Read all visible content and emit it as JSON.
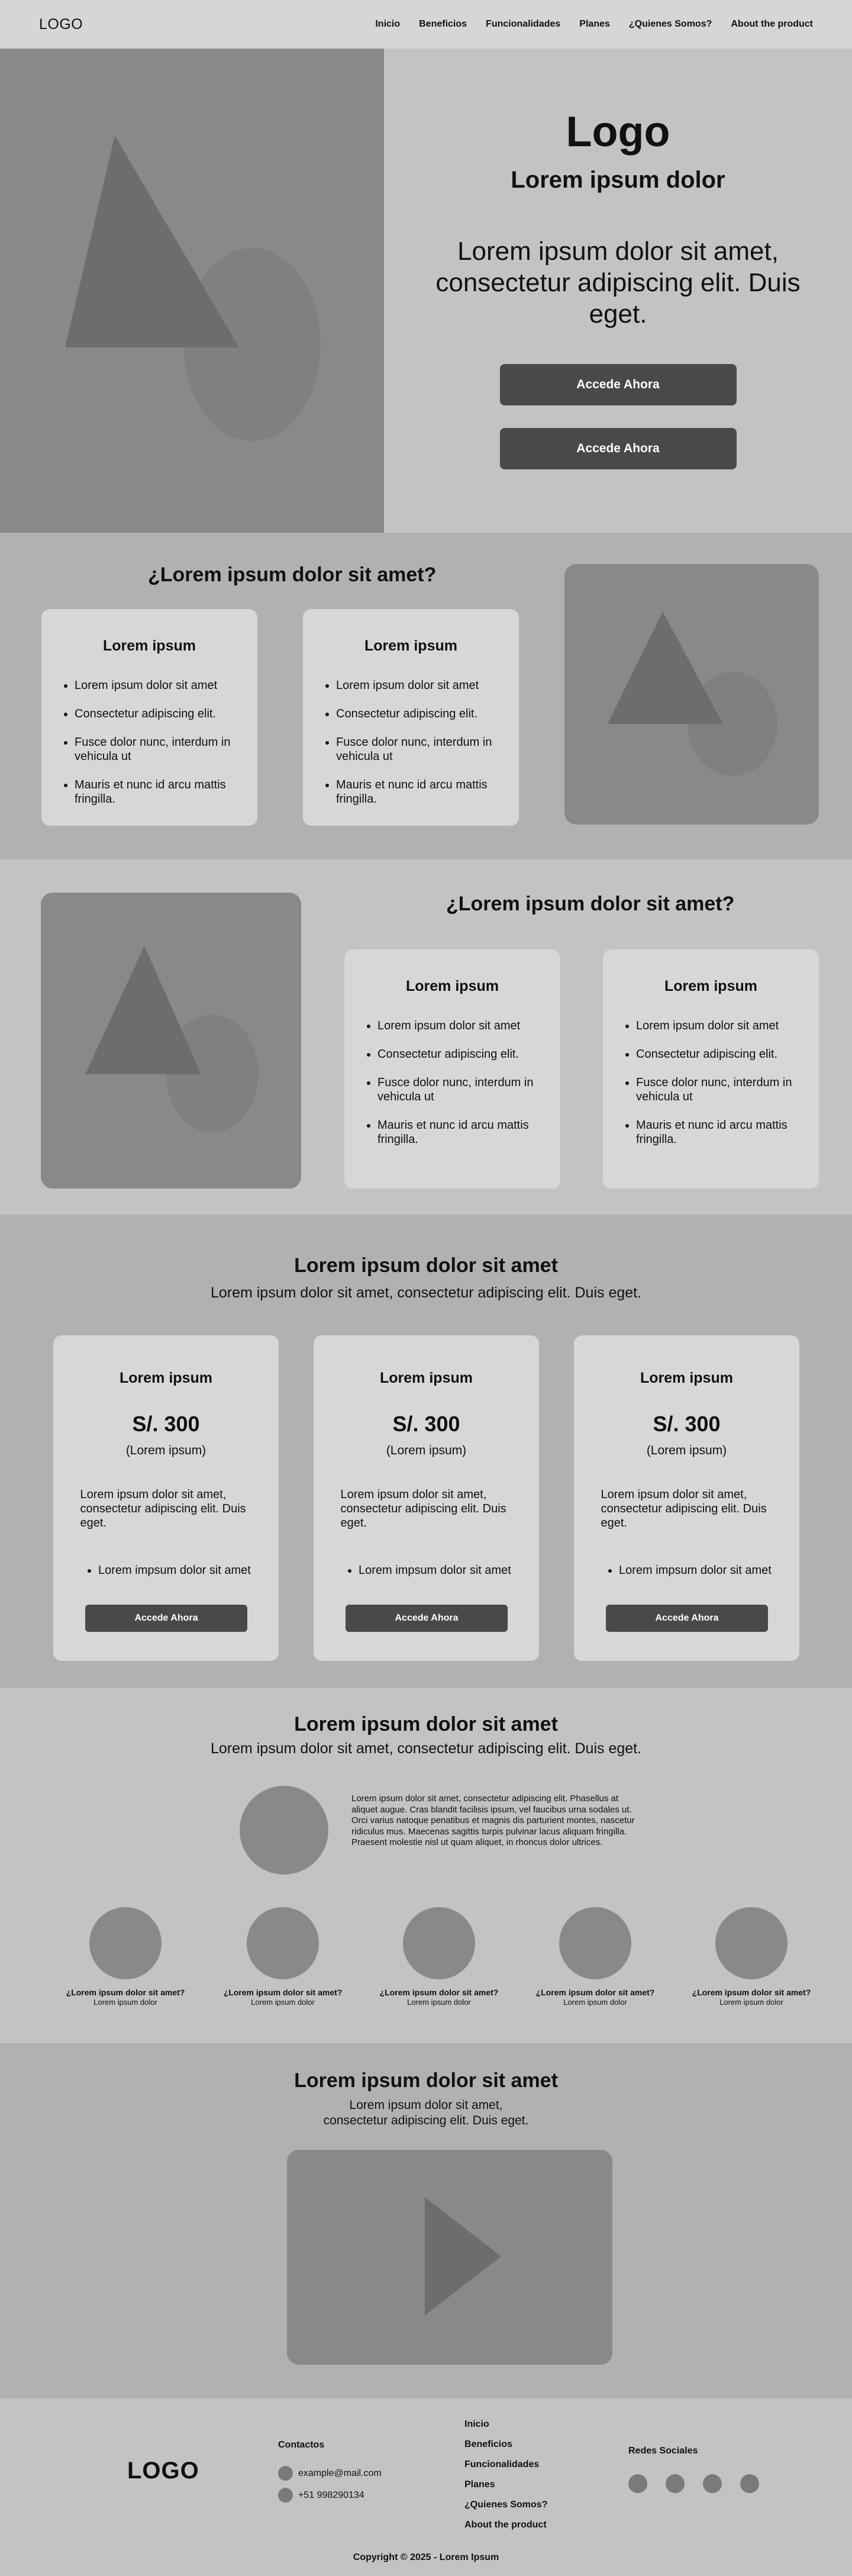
{
  "nav": {
    "logo": "LOGO",
    "items": [
      "Inicio",
      "Beneficios",
      "Funcionalidades",
      "Planes",
      "¿Quienes Somos?",
      "About the product"
    ]
  },
  "hero": {
    "title": "Logo",
    "subtitle": "Lorem ipsum dolor",
    "text": "Lorem ipsum dolor sit amet, consectetur adipiscing elit. Duis eget.",
    "button1": "Accede Ahora",
    "button2": "Accede Ahora"
  },
  "features1": {
    "title": "¿Lorem ipsum dolor sit amet?",
    "cards": [
      {
        "title": "Lorem ipsum",
        "items": [
          "Lorem ipsum dolor sit amet",
          "Consectetur adipiscing elit.",
          "Fusce dolor nunc, interdum in vehicula ut",
          "Mauris et nunc id arcu mattis fringilla."
        ]
      },
      {
        "title": "Lorem ipsum",
        "items": [
          "Lorem ipsum dolor sit amet",
          "Consectetur adipiscing elit.",
          "Fusce dolor nunc, interdum in vehicula ut",
          "Mauris et nunc id arcu mattis fringilla."
        ]
      }
    ]
  },
  "features2": {
    "title": "¿Lorem ipsum dolor sit amet?",
    "cards": [
      {
        "title": "Lorem ipsum",
        "items": [
          "Lorem ipsum dolor sit amet",
          "Consectetur adipiscing elit.",
          "Fusce dolor nunc, interdum in vehicula ut",
          "Mauris et nunc id arcu mattis fringilla."
        ]
      },
      {
        "title": "Lorem ipsum",
        "items": [
          "Lorem ipsum dolor sit amet",
          "Consectetur adipiscing elit.",
          "Fusce dolor nunc, interdum in vehicula ut",
          "Mauris et nunc id arcu mattis fringilla."
        ]
      }
    ]
  },
  "pricing": {
    "title": "Lorem ipsum dolor sit amet",
    "subtitle": "Lorem ipsum dolor sit amet, consectetur adipiscing elit. Duis eget.",
    "plans": [
      {
        "title": "Lorem ipsum",
        "price": "S/. 300",
        "note": "(Lorem ipsum)",
        "desc": "Lorem ipsum dolor sit amet, consectetur adipiscing elit. Duis eget.",
        "feature": "Lorem impsum dolor sit amet",
        "button": "Accede Ahora"
      },
      {
        "title": "Lorem ipsum",
        "price": "S/. 300",
        "note": "(Lorem ipsum)",
        "desc": "Lorem ipsum dolor sit amet, consectetur adipiscing elit. Duis eget.",
        "feature": "Lorem impsum dolor sit amet",
        "button": "Accede Ahora"
      },
      {
        "title": "Lorem ipsum",
        "price": "S/. 300",
        "note": "(Lorem ipsum)",
        "desc": "Lorem ipsum dolor sit amet, consectetur adipiscing elit. Duis eget.",
        "feature": "Lorem impsum dolor sit amet",
        "button": "Accede Ahora"
      }
    ]
  },
  "team": {
    "title": "Lorem ipsum dolor sit amet",
    "subtitle": "Lorem ipsum dolor sit amet, consectetur adipiscing elit. Duis eget.",
    "paragraph": "Lorem ipsum dolor sit amet, consectetur adipiscing elit. Phasellus at aliquet augue. Cras blandit facilisis ipsum, vel faucibus urna sodales ut. Orci varius natoque penatibus et magnis dis parturient montes, nascetur ridiculus mus. Maecenas sagittis turpis pulvinar lacus aliquam fringilla. Praesent molestie nisl ut quam aliquet, in rhoncus dolor ultrices.",
    "members": [
      {
        "question": "¿Lorem ipsum dolor sit amet?",
        "role": "Lorem ipsum dolor"
      },
      {
        "question": "¿Lorem ipsum dolor sit amet?",
        "role": "Lorem ipsum dolor"
      },
      {
        "question": "¿Lorem ipsum dolor sit amet?",
        "role": "Lorem ipsum dolor"
      },
      {
        "question": "¿Lorem ipsum dolor sit amet?",
        "role": "Lorem ipsum dolor"
      },
      {
        "question": "¿Lorem ipsum dolor sit amet?",
        "role": "Lorem ipsum dolor"
      }
    ]
  },
  "video": {
    "title": "Lorem ipsum dolor sit amet",
    "subtitle": "Lorem ipsum dolor sit amet, consectetur adipiscing elit. Duis eget.",
    "icon": "play-icon"
  },
  "footer": {
    "logo": "LOGO",
    "contacts_title": "Contactos",
    "email": "example@mail.com",
    "phone": "+51 998290134",
    "links": [
      "Inicio",
      "Beneficios",
      "Funcionalidades",
      "Planes",
      "¿Quienes Somos?",
      "About the product"
    ],
    "social_title": "Redes Sociales",
    "copyright": "Copyright © 2025 - Lorem Ipsum"
  },
  "colors": {
    "nav_bg": "#d6d6d6",
    "placeholder": "#898989",
    "shape": "#6d6d6d",
    "button": "#4a4848",
    "card": "#d7d7d7"
  }
}
